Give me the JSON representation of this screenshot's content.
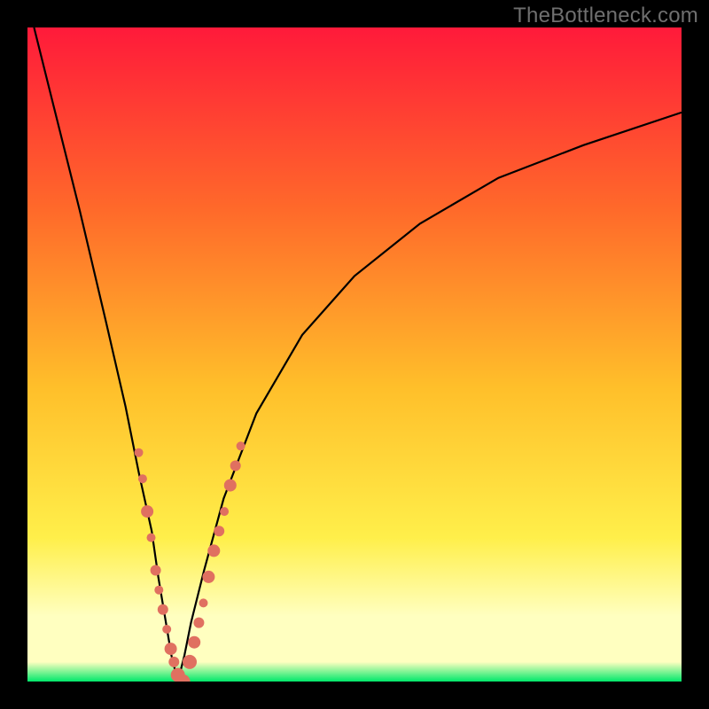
{
  "watermark": "TheBottleneck.com",
  "colors": {
    "top": "#ff1a3a",
    "mid_upper": "#ff6a2a",
    "mid": "#ffbf2a",
    "mid_lower": "#ffef4a",
    "pale": "#ffffc0",
    "green": "#00e86a",
    "curve": "#000000",
    "bead": "#e07060",
    "frame": "#000000",
    "watermark_color": "#6f6f6f"
  },
  "chart_data": {
    "type": "line",
    "title": "",
    "xlabel": "",
    "ylabel": "",
    "xlim": [
      0,
      100
    ],
    "ylim": [
      0,
      100
    ],
    "notes": "Bottleneck-style V curve. Minimum near x≈23. Left branch steep; right branch shallow asymptote. Coral bead clusters near bottom of V on both branches.",
    "series": [
      {
        "name": "left-branch",
        "x": [
          1,
          4,
          8,
          12,
          15,
          17,
          19,
          20,
          21,
          22,
          23
        ],
        "y": [
          100,
          88,
          72,
          55,
          42,
          32,
          23,
          16,
          10,
          4,
          0
        ]
      },
      {
        "name": "right-branch",
        "x": [
          23,
          24,
          25,
          27,
          30,
          35,
          42,
          50,
          60,
          72,
          85,
          100
        ],
        "y": [
          0,
          4,
          9,
          17,
          28,
          41,
          53,
          62,
          70,
          77,
          82,
          87
        ]
      }
    ],
    "beads_left": [
      {
        "x": 17.0,
        "y": 35,
        "r": 5
      },
      {
        "x": 17.6,
        "y": 31,
        "r": 5
      },
      {
        "x": 18.3,
        "y": 26,
        "r": 7
      },
      {
        "x": 18.9,
        "y": 22,
        "r": 5
      },
      {
        "x": 19.6,
        "y": 17,
        "r": 6
      },
      {
        "x": 20.1,
        "y": 14,
        "r": 5
      },
      {
        "x": 20.7,
        "y": 11,
        "r": 6
      },
      {
        "x": 21.3,
        "y": 8,
        "r": 5
      },
      {
        "x": 21.9,
        "y": 5,
        "r": 7
      },
      {
        "x": 22.4,
        "y": 3,
        "r": 6
      },
      {
        "x": 23.0,
        "y": 1,
        "r": 8
      },
      {
        "x": 23.8,
        "y": 0,
        "r": 8
      }
    ],
    "beads_right": [
      {
        "x": 24.8,
        "y": 3,
        "r": 8
      },
      {
        "x": 25.5,
        "y": 6,
        "r": 7
      },
      {
        "x": 26.2,
        "y": 9,
        "r": 6
      },
      {
        "x": 26.9,
        "y": 12,
        "r": 5
      },
      {
        "x": 27.7,
        "y": 16,
        "r": 7
      },
      {
        "x": 28.5,
        "y": 20,
        "r": 7
      },
      {
        "x": 29.3,
        "y": 23,
        "r": 6
      },
      {
        "x": 30.1,
        "y": 26,
        "r": 5
      },
      {
        "x": 31.0,
        "y": 30,
        "r": 7
      },
      {
        "x": 31.8,
        "y": 33,
        "r": 6
      },
      {
        "x": 32.6,
        "y": 36,
        "r": 5
      }
    ]
  }
}
